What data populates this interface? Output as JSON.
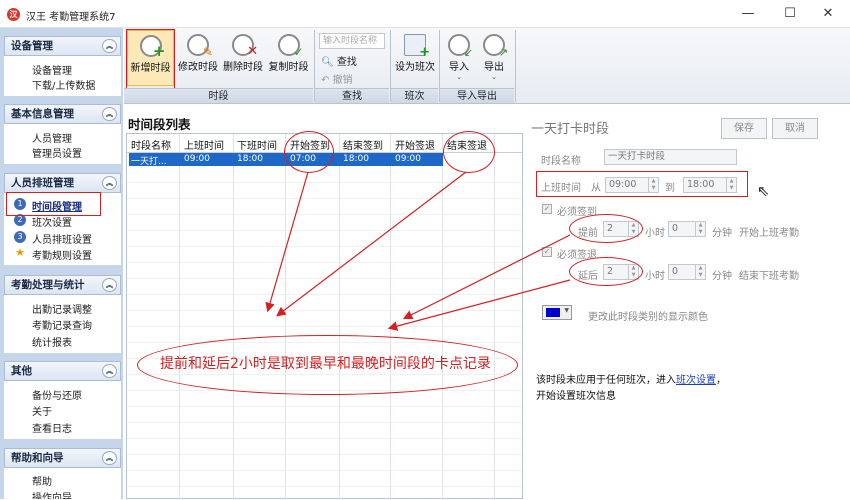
{
  "window": {
    "title": "汉王 考勤管理系统7",
    "logo_text": "汉",
    "controls": {
      "minimize": "—",
      "maximize": "☐",
      "close": "✕"
    }
  },
  "sidebar": {
    "groups": [
      {
        "title": "设备管理",
        "items": [
          "设备管理",
          "下载/上传数据"
        ]
      },
      {
        "title": "基本信息管理",
        "items": [
          "人员管理",
          "管理员设置"
        ]
      },
      {
        "title": "人员排班管理",
        "items": [
          "时间段管理",
          "班次设置",
          "人员排班设置",
          "考勤规则设置"
        ],
        "item_icons": [
          "1",
          "2",
          "3",
          "★"
        ]
      },
      {
        "title": "考勤处理与统计",
        "items": [
          "出勤记录调整",
          "考勤记录查询",
          "统计报表"
        ]
      },
      {
        "title": "其他",
        "items": [
          "备份与还原",
          "关于",
          "查看日志"
        ]
      },
      {
        "title": "帮助和向导",
        "items": [
          "帮助",
          "操作向导"
        ]
      }
    ],
    "selected_item": "时间段管理"
  },
  "ribbon": {
    "buttons": {
      "new": "新增时段",
      "edit": "修改时段",
      "delete": "删除时段",
      "copy": "复制时段",
      "set_shift": "设为班次",
      "import": "导入",
      "export": "导出"
    },
    "search_placeholder": "输入时段名称",
    "search": "查找",
    "cancel": "撤销",
    "groups": [
      "时段",
      "查找",
      "班次",
      "导入导出"
    ]
  },
  "list": {
    "title": "时间段列表",
    "columns": [
      "时段名称",
      "上班时间",
      "下班时间",
      "开始签到",
      "结束签到",
      "开始签退",
      "结束签退"
    ],
    "rows": [
      [
        "一天打...",
        "09:00",
        "18:00",
        "07:00",
        "18:00",
        "09:00",
        "20:00"
      ]
    ]
  },
  "detail": {
    "title": "一天打卡时段",
    "save": "保存",
    "cancel": "取消",
    "name_label": "时段名称",
    "name_value": "一天打卡时段",
    "work_time_label": "上班时间",
    "from_label": "从",
    "from_value": "09:00",
    "to_label": "到",
    "to_value": "18:00",
    "must_signin": "必须签到",
    "advance_label": "提前",
    "advance_hours": "2",
    "advance_minutes": "0",
    "hour_unit": "小时",
    "minute_unit": "分钟",
    "advance_suffix": "开始上班考勤",
    "must_signout": "必须签退",
    "delay_label": "延后",
    "delay_hours": "2",
    "delay_minutes": "0",
    "delay_suffix": "结束下班考勤",
    "color_label": "更改此时段类别的显示颜色",
    "color_value": "#0000cc",
    "info_line1_pre": "该时段未应用于任何班次，进入",
    "info_link": "班次设置",
    "info_line1_post": "，",
    "info_line2": "开始设置班次信息"
  },
  "annotation": "提前和延后2小时是取到最早和最晚时间段的卡点记录"
}
